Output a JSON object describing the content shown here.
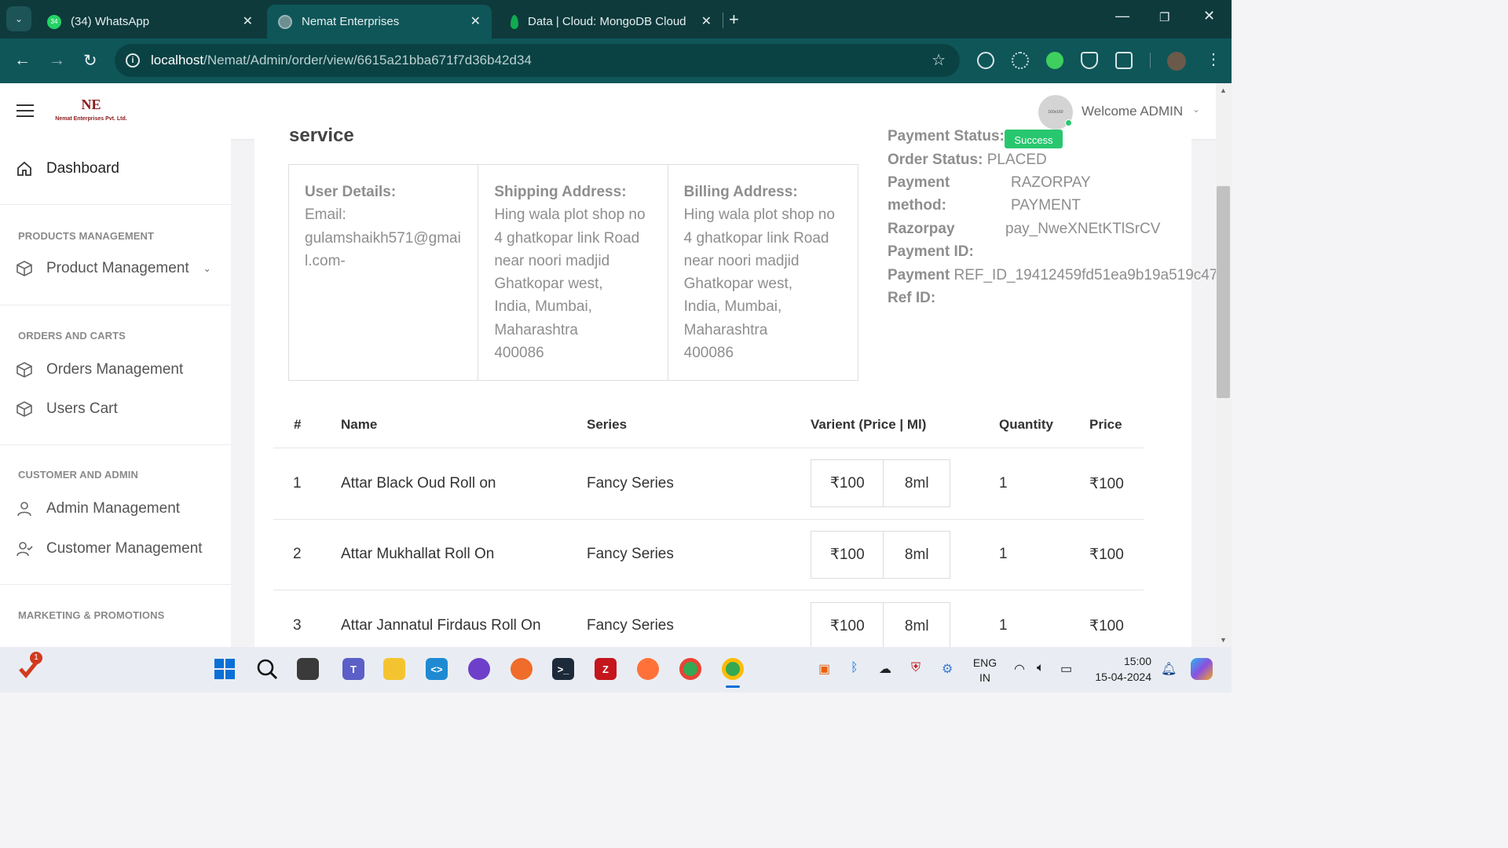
{
  "browser": {
    "tabs": [
      {
        "title": "(34) WhatsApp",
        "badge": "34"
      },
      {
        "title": "Nemat Enterprises"
      },
      {
        "title": "Data | Cloud: MongoDB Cloud"
      }
    ],
    "url_host": "localhost",
    "url_path": "/Nemat/Admin/order/view/6615a21bba671f7d36b42d34"
  },
  "header": {
    "logo_mark": "NE",
    "logo_caption": "Nemat Enterprises Pvt. Ltd.",
    "avatar_text": "160x160",
    "welcome": "Welcome ADMIN"
  },
  "sidebar": {
    "dashboard": "Dashboard",
    "sections": [
      {
        "heading": "PRODUCTS MANAGEMENT",
        "items": [
          "Product Management"
        ]
      },
      {
        "heading": "ORDERS AND CARTS",
        "items": [
          "Orders Management",
          "Users Cart"
        ]
      },
      {
        "heading": "CUSTOMER AND ADMIN",
        "items": [
          "Admin Management",
          "Customer Management"
        ]
      },
      {
        "heading": "MARKETING & PROMOTIONS",
        "items": []
      }
    ]
  },
  "order": {
    "section_title": "service",
    "user_details": {
      "heading": "User Details:",
      "email_label": "Email:",
      "email": "gulamshaikh571@gmail.com-"
    },
    "shipping": {
      "heading": "Shipping Address:",
      "lines": [
        "Hing wala plot shop no",
        "4 ghatkopar link Road",
        "near noori madjid",
        "Ghatkopar west,",
        "India, Mumbai,",
        "Maharashtra",
        "400086"
      ]
    },
    "billing": {
      "heading": "Billing Address:",
      "lines": [
        "Hing wala plot shop no",
        "4 ghatkopar link Road",
        "near noori madjid",
        "Ghatkopar west,",
        "India, Mumbai,",
        "Maharashtra",
        "400086"
      ]
    },
    "payment_status_label": "Payment Status:",
    "payment_status": "Success",
    "order_status_label": "Order Status:",
    "order_status": "PLACED",
    "payment_method_label_1": "Payment",
    "payment_method_label_2": "method:",
    "payment_method_1": "RAZORPAY",
    "payment_method_2": "PAYMENT",
    "razorpay_label_1": "Razorpay",
    "razorpay_label_2": "Payment ID:",
    "razorpay_id": "pay_NweXNEtKTlSrCV",
    "ref_label_1": "Payment",
    "ref_label_2": "Ref ID:",
    "ref_id": "REF_ID_19412459fd51ea9b19a519c47"
  },
  "table": {
    "headers": [
      "#",
      "Name",
      "Series",
      "Varient (Price | Ml)",
      "Quantity",
      "Price"
    ],
    "rows": [
      {
        "num": "1",
        "name": "Attar Black Oud Roll on",
        "series": "Fancy Series",
        "v_price": "₹100",
        "v_ml": "8ml",
        "qty": "1",
        "price": "₹100"
      },
      {
        "num": "2",
        "name": "Attar Mukhallat Roll On",
        "series": "Fancy Series",
        "v_price": "₹100",
        "v_ml": "8ml",
        "qty": "1",
        "price": "₹100"
      },
      {
        "num": "3",
        "name": "Attar Jannatul Firdaus Roll On",
        "series": "Fancy Series",
        "v_price": "₹100",
        "v_ml": "8ml",
        "qty": "1",
        "price": "₹100"
      }
    ]
  },
  "taskbar": {
    "lang_1": "ENG",
    "lang_2": "IN",
    "time": "15:00",
    "date": "15-04-2024",
    "notif_badge": "1"
  }
}
